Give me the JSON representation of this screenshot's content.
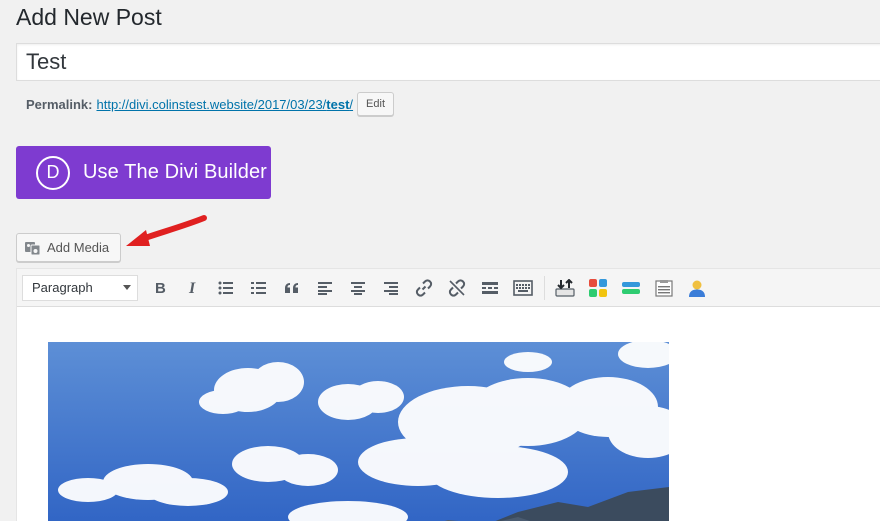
{
  "page": {
    "title": "Add New Post"
  },
  "post": {
    "title_value": "Test"
  },
  "permalink": {
    "label": "Permalink:",
    "url_base": "http://divi.colinstest.website/2017/03/23/",
    "slug": "test",
    "url_tail": "/",
    "edit_label": "Edit"
  },
  "divi": {
    "logo_letter": "D",
    "button_label": "Use The Divi Builder",
    "color": "#7e3bd0"
  },
  "media": {
    "add_media_label": "Add Media"
  },
  "toolbar": {
    "format_selected": "Paragraph",
    "buttons": [
      "bold-icon",
      "italic-icon",
      "bullet-list-icon",
      "numbered-list-icon",
      "blockquote-icon",
      "align-left-icon",
      "align-center-icon",
      "align-right-icon",
      "link-icon",
      "unlink-icon",
      "read-more-icon",
      "toolbar-toggle-icon",
      "divi-layout-icon",
      "shortcode-icon",
      "divider-icon",
      "table-icon",
      "user-icon"
    ]
  },
  "colors": {
    "link": "#0073aa",
    "arrow": "#e02020",
    "background": "#f1f1f1"
  }
}
